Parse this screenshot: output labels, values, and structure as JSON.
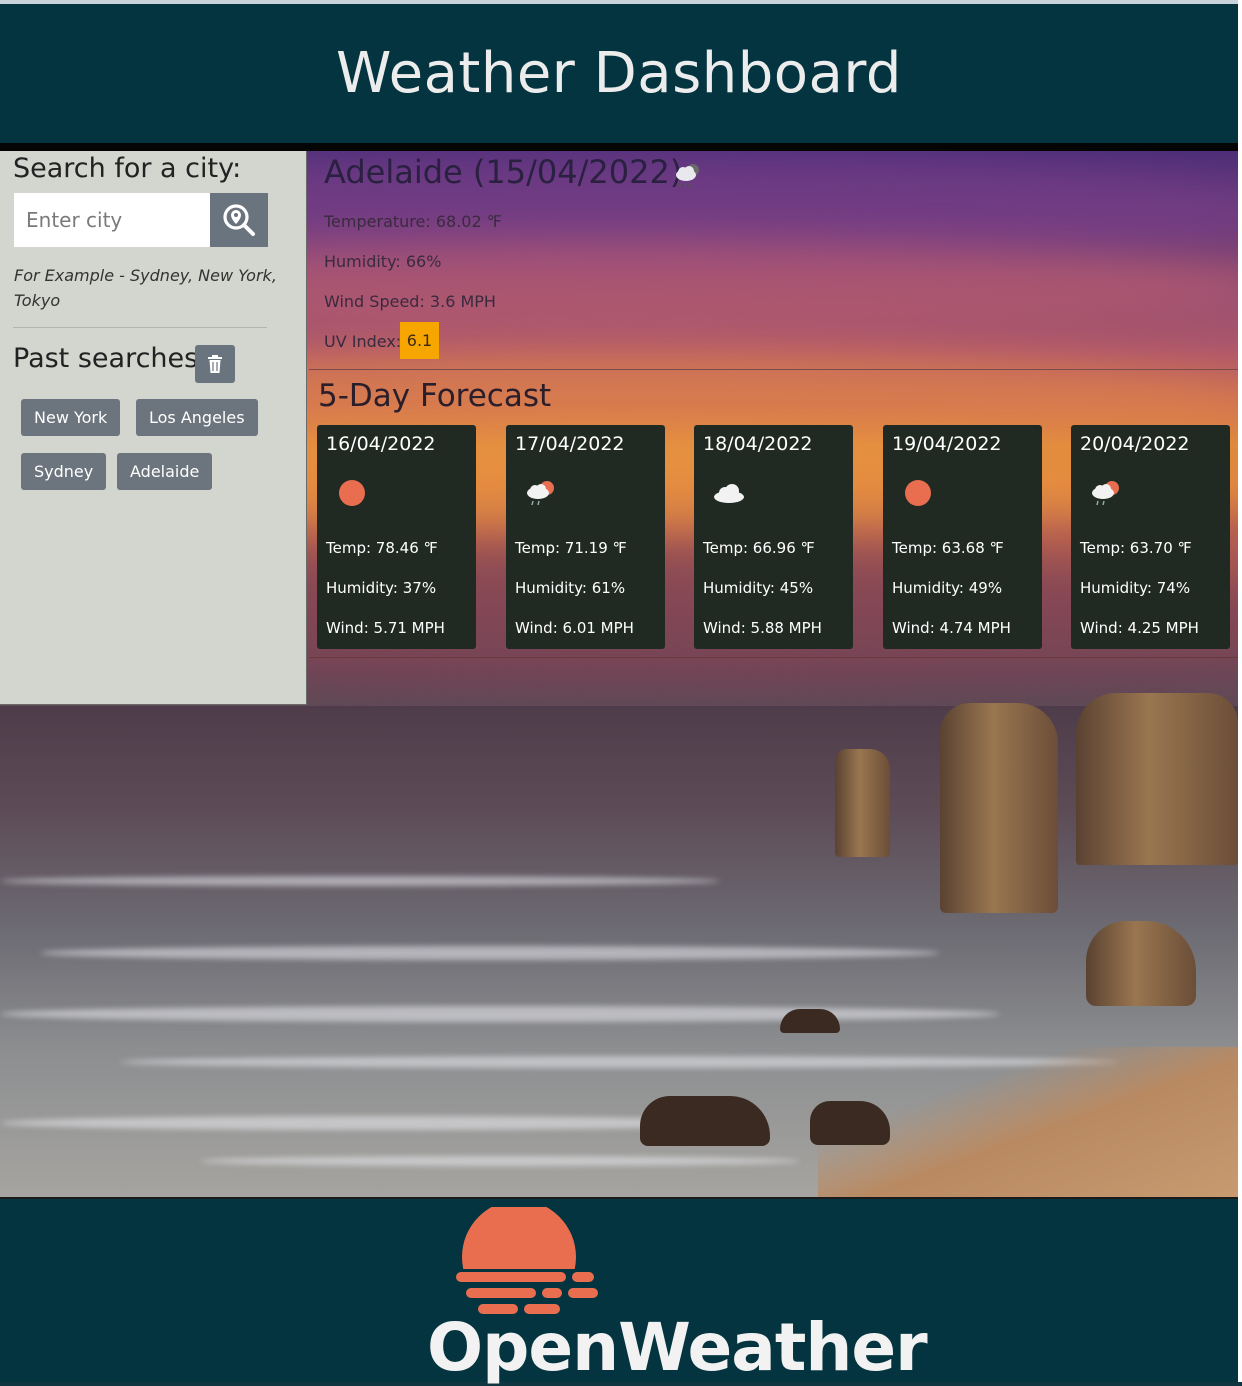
{
  "header": {
    "title": "Weather Dashboard"
  },
  "sidebar": {
    "search_title": "Search for a city:",
    "search_placeholder": "Enter city",
    "search_icon": "map-search-icon",
    "example": "For Example - Sydney, New York, Tokyo",
    "past_title": "Past searches",
    "trash_icon": "trash-icon",
    "past_searches": [
      "New York",
      "Los Angeles",
      "Sydney",
      "Adelaide"
    ]
  },
  "current": {
    "title": "Adelaide (15/04/2022)",
    "icon": "cloud-rain-icon",
    "temperature": "Temperature: 68.02 ℉",
    "humidity": "Humidity: 66%",
    "wind": "Wind Speed: 3.6 MPH",
    "uv_label": "UV Index:",
    "uv_value": "6.1",
    "uv_color": "#f7a600"
  },
  "forecast": {
    "title": "5-Day Forecast",
    "days": [
      {
        "date": "16/04/2022",
        "icon": "sun-icon",
        "temp": "Temp: 78.46 ℉",
        "humidity": "Humidity: 37%",
        "wind": "Wind: 5.71 MPH"
      },
      {
        "date": "17/04/2022",
        "icon": "sun-cloud-rain-icon",
        "temp": "Temp: 71.19 ℉",
        "humidity": "Humidity: 61%",
        "wind": "Wind: 6.01 MPH"
      },
      {
        "date": "18/04/2022",
        "icon": "cloud-icon",
        "temp": "Temp: 66.96 ℉",
        "humidity": "Humidity: 45%",
        "wind": "Wind: 5.88 MPH"
      },
      {
        "date": "19/04/2022",
        "icon": "sun-icon",
        "temp": "Temp: 63.68 ℉",
        "humidity": "Humidity: 49%",
        "wind": "Wind: 4.74 MPH"
      },
      {
        "date": "20/04/2022",
        "icon": "sun-cloud-rain-icon",
        "temp": "Temp: 63.70 ℉",
        "humidity": "Humidity: 74%",
        "wind": "Wind: 4.25 MPH"
      }
    ]
  },
  "footer": {
    "brand": "OpenWeather",
    "brand_color": "#e96e50"
  }
}
